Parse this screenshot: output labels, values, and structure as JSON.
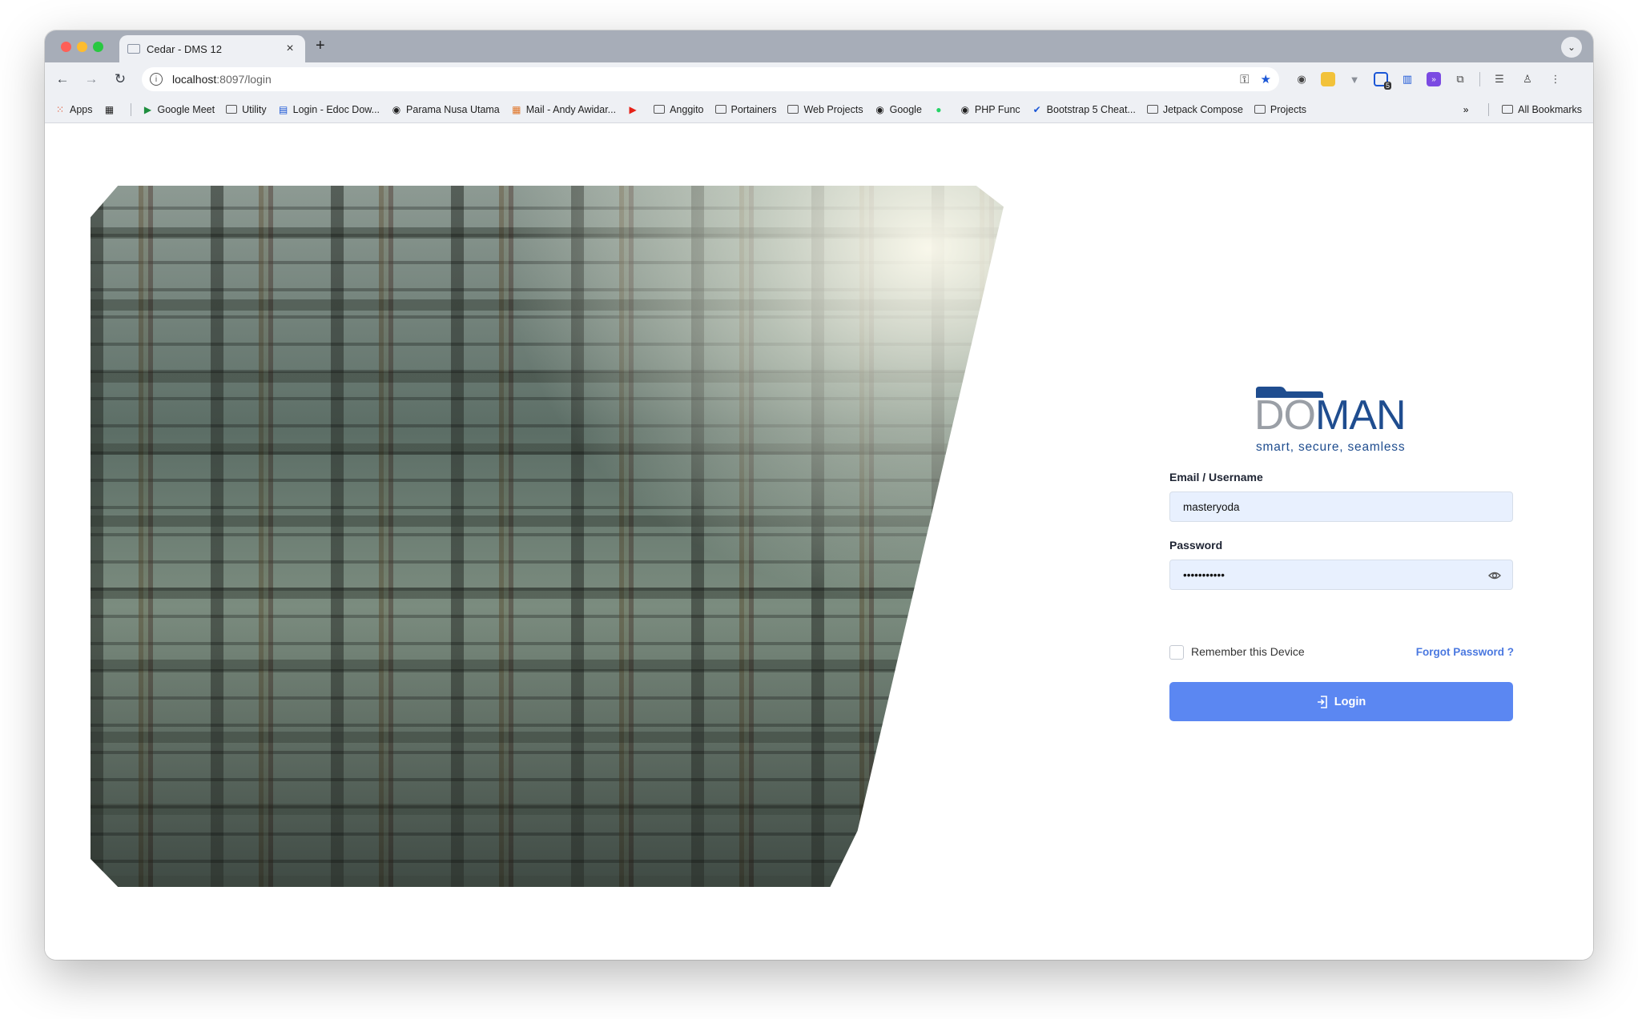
{
  "browser": {
    "tab_title": "Cedar - DMS 12",
    "new_tab_symbol": "+",
    "url_host": "localhost",
    "url_path": ":8097/login",
    "extension_badge": "5"
  },
  "bookmarks": [
    {
      "label": "Apps",
      "icon": "apps-grid-icon"
    },
    {
      "label": "",
      "icon": "tab-groups-icon"
    },
    {
      "label": "Google Meet",
      "icon": "google-meet-icon"
    },
    {
      "label": "Utility",
      "icon": "folder-icon"
    },
    {
      "label": "Login - Edoc Dow...",
      "icon": "edoc-icon"
    },
    {
      "label": "Parama Nusa Utama",
      "icon": "globe-icon"
    },
    {
      "label": "Mail - Andy Awidar...",
      "icon": "microsoft-icon"
    },
    {
      "label": "",
      "icon": "youtube-icon"
    },
    {
      "label": "Anggito",
      "icon": "folder-icon"
    },
    {
      "label": "Portainers",
      "icon": "folder-icon"
    },
    {
      "label": "Web Projects",
      "icon": "folder-icon"
    },
    {
      "label": "Google",
      "icon": "globe-icon"
    },
    {
      "label": "",
      "icon": "whatsapp-icon"
    },
    {
      "label": "PHP Func",
      "icon": "globe-icon"
    },
    {
      "label": "Bootstrap 5 Cheat...",
      "icon": "check-icon"
    },
    {
      "label": "Jetpack Compose",
      "icon": "folder-icon"
    },
    {
      "label": "Projects",
      "icon": "folder-icon"
    }
  ],
  "all_bookmarks": "All Bookmarks",
  "login": {
    "logo_do": "DO",
    "logo_man": "MAN",
    "logo_tagline": "smart, secure, seamless",
    "email_label": "Email / Username",
    "email_value": "masteryoda",
    "password_label": "Password",
    "password_value": "•••••••••••",
    "remember_label": "Remember this Device",
    "forgot_label": "Forgot Password ?",
    "login_button": "Login"
  },
  "colors": {
    "primary_button": "#5b87f2",
    "link": "#4a78e0",
    "logo_blue": "#1f4d8f",
    "logo_gray": "#9a9fa6",
    "input_bg": "#e8f0fe"
  }
}
